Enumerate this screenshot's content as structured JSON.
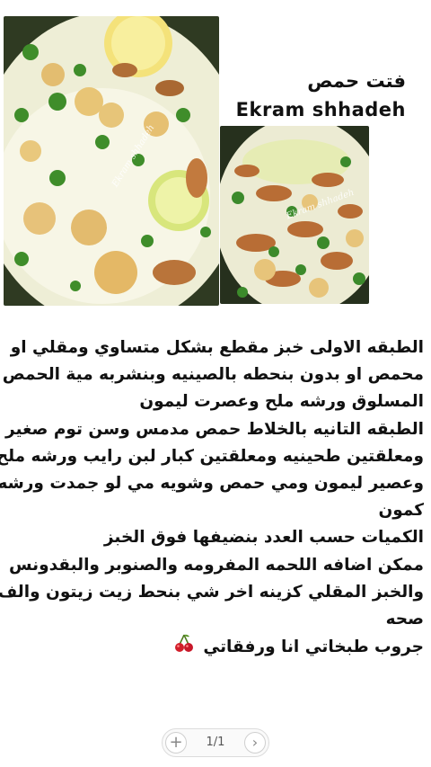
{
  "recipe": {
    "title": "فتت حمص",
    "author": "Ekram shhadeh",
    "lines": [
      "الطبقه الاولى خبز مقطع بشكل متساوي ومقلي او",
      "محمص او بدون بنحطه بالصينيه وبنشربه مية الحمص",
      "المسلوق ورشه ملح وعصرت ليمون",
      "الطبقه التانيه  بالخلاط حمص مدمس وسن توم صغير",
      "ومعلقتين طحينيه ومعلقتين كبار لبن رايب  ورشه ملح",
      "وعصير ليمون ومي حمص وشويه مي لو جمدت ورشه",
      "كمون",
      "الكميات حسب العدد بنضيفها فوق الخبز",
      "ممكن اضافه اللحمه المفرومه والصنوبر والبقدونس",
      "والخبز المقلي كزينه اخر شي بنحط زيت زيتون والف",
      "صحه",
      "جروب طبخاتي انا ورفقاتي"
    ],
    "emoji": "🍒"
  },
  "photos": {
    "watermark": "Ekram shhadeh"
  },
  "pager": {
    "add_icon": "plus-icon",
    "page_indicator": "1/1",
    "next_icon": "chevron-right-icon"
  }
}
